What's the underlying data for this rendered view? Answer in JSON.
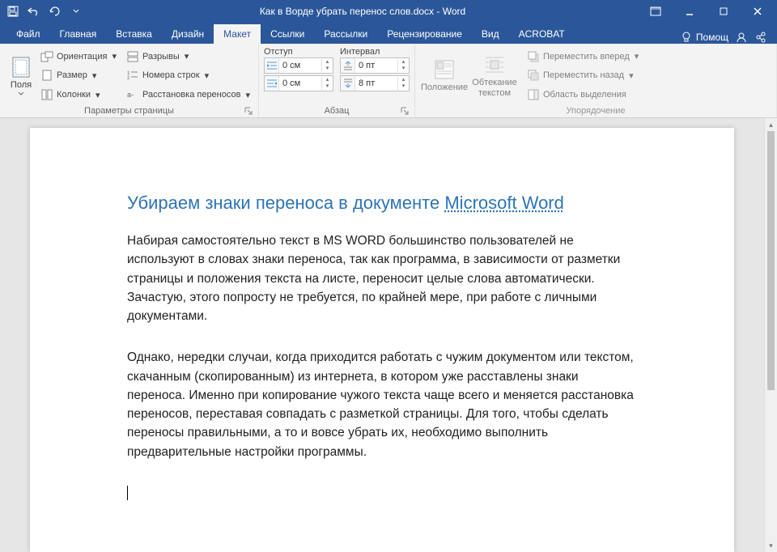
{
  "colors": {
    "brand": "#2b579a",
    "accent_text": "#2e74b5"
  },
  "titlebar": {
    "title": "Как в Ворде убрать перенос слов.docx - Word"
  },
  "tabs": {
    "items": [
      {
        "label": "Файл"
      },
      {
        "label": "Главная"
      },
      {
        "label": "Вставка"
      },
      {
        "label": "Дизайн"
      },
      {
        "label": "Макет"
      },
      {
        "label": "Ссылки"
      },
      {
        "label": "Рассылки"
      },
      {
        "label": "Рецензирование"
      },
      {
        "label": "Вид"
      },
      {
        "label": "ACROBAT"
      }
    ],
    "active_index": 4,
    "help_label": "Помощ"
  },
  "ribbon": {
    "page_setup": {
      "margins_label": "Поля",
      "orientation_label": "Ориентация",
      "size_label": "Размер",
      "columns_label": "Колонки",
      "breaks_label": "Разрывы",
      "line_numbers_label": "Номера строк",
      "hyphenation_label": "Расстановка переносов",
      "group_label": "Параметры страницы"
    },
    "paragraph": {
      "indent_header": "Отступ",
      "spacing_header": "Интервал",
      "indent_left_value": "0 см",
      "indent_right_value": "0 см",
      "spacing_before_value": "0 пт",
      "spacing_after_value": "8 пт",
      "group_label": "Абзац"
    },
    "arrange": {
      "position_label": "Положение",
      "wrap_label": "Обтекание текстом",
      "bring_forward_label": "Переместить вперед",
      "send_backward_label": "Переместить назад",
      "selection_pane_label": "Область выделения",
      "group_label": "Упорядочение"
    }
  },
  "document": {
    "heading_prefix": "Убираем знаки переноса в документе ",
    "heading_link": "Microsoft Word",
    "paragraph1": "Набирая самостоятельно текст в MS WORD большинство пользователей не используют в словах знаки переноса, так как программа, в зависимости от разметки страницы и положения текста на листе, переносит целые слова автоматически. Зачастую, этого попросту не требуется, по крайней мере, при работе с личными документами.",
    "paragraph2": "Однако, нередки случаи, когда приходится работать с чужим документом или текстом, скачанным (скопированным) из интернета, в котором уже расставлены знаки переноса. Именно при копирование чужого текста чаще всего и меняется расстановка переносов, переставая совпадать с разметкой страницы. Для того, чтобы сделать переносы правильными, а то и вовсе убрать их, необходимо выполнить предварительные настройки программы."
  }
}
